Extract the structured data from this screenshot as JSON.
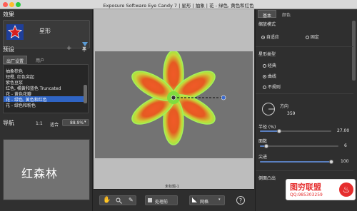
{
  "window": {
    "title": "Exposure Software Eye Candy 7 | 星形 | 抽象 | 花 - 绿色, 黄色和红色"
  },
  "effect": {
    "heading": "效果",
    "name": "星形"
  },
  "presets": {
    "heading": "预设",
    "tabs": [
      "出厂设置",
      "用户"
    ],
    "items": [
      "抽象棕色",
      "短橙, 红色突起",
      "紫色豆浆",
      "红色, 橘黄和蓝色 Truncated",
      "花 - 黄色花瓣",
      "花 - 绿色, 黄色和红色",
      "花 - 绿色和粉色"
    ],
    "selected_index": 5
  },
  "navigation": {
    "heading": "导航",
    "ratio_label": "1:1",
    "fit_label": "适合",
    "zoom_value": "88.9%",
    "thumb_text": "红森林"
  },
  "canvas": {
    "status_label": "未标题-1"
  },
  "toolbar": {
    "process_label": "处理前",
    "grid_label": "网格"
  },
  "tabs": {
    "basic": "基本",
    "color": "颜色"
  },
  "settings": {
    "scale_mode": {
      "heading": "缩放模式",
      "options": [
        "自适应",
        "固定"
      ],
      "selected": "自适应"
    },
    "star_type": {
      "heading": "星形类型",
      "options": [
        "经典",
        "曲线",
        "不规则"
      ],
      "selected": "曲线"
    },
    "direction": {
      "label": "方向",
      "value": "359"
    },
    "radius": {
      "label": "半径 (%)",
      "value": "27.00",
      "fraction": 0.27
    },
    "sides": {
      "label": "面数",
      "value": "6",
      "fraction": 0.08
    },
    "sharpness": {
      "label": "尖进",
      "value": "100",
      "fraction": 1.0
    },
    "bevel": {
      "label": "倒面凸出"
    }
  },
  "watermark": {
    "brand": "图穷联盟",
    "qq": "QQ:985303259"
  },
  "colors": {
    "accent": "#5a7fbf",
    "selected": "#2f64c4",
    "petal_outer": "#9bf04a",
    "petal_inner": "#f05a28",
    "watermark": "#e52e2e"
  }
}
